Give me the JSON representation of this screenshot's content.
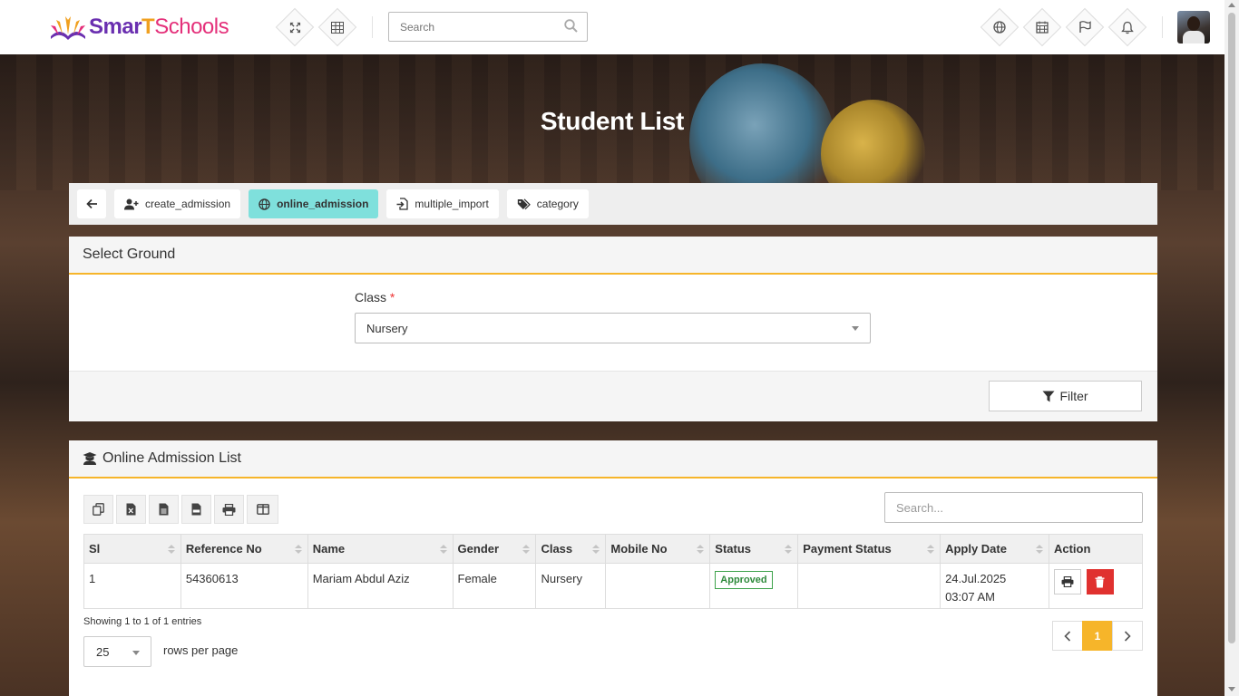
{
  "app": {
    "logo_text_a": "Smar",
    "logo_text_b": "T",
    "logo_text_c": "Schools"
  },
  "topbar": {
    "search_placeholder": "Search"
  },
  "page_title": "Student List",
  "tabs": [
    {
      "label": "create_admission",
      "icon": "user-plus-icon"
    },
    {
      "label": "online_admission",
      "icon": "globe-icon",
      "active": true
    },
    {
      "label": "multiple_import",
      "icon": "file-import-icon"
    },
    {
      "label": "category",
      "icon": "tags-icon"
    }
  ],
  "select_panel": {
    "title": "Select Ground",
    "class_label": "Class",
    "required_mark": "*",
    "class_value": "Nursery",
    "filter_label": "Filter"
  },
  "list_panel": {
    "title": "Online Admission List",
    "search_placeholder": "Search...",
    "columns": [
      "Sl",
      "Reference No",
      "Name",
      "Gender",
      "Class",
      "Mobile No",
      "Status",
      "Payment Status",
      "Apply Date",
      "Action"
    ],
    "rows": [
      {
        "sl": "1",
        "reference_no": "54360613",
        "name": "Mariam Abdul Aziz",
        "gender": "Female",
        "class": "Nursery",
        "mobile_no": "",
        "status": "Approved",
        "payment_status": "",
        "apply_date_line1": "24.Jul.2025",
        "apply_date_line2": "03:07 AM"
      }
    ],
    "showing": "Showing 1 to 1 of 1 entries",
    "rows_per_page_value": "25",
    "rows_per_page_label": "rows per page",
    "current_page": "1"
  },
  "colors": {
    "accent": "#f6b52a",
    "active_tab": "#7fe0dc",
    "danger": "#e0312f",
    "success": "#3da24a"
  }
}
